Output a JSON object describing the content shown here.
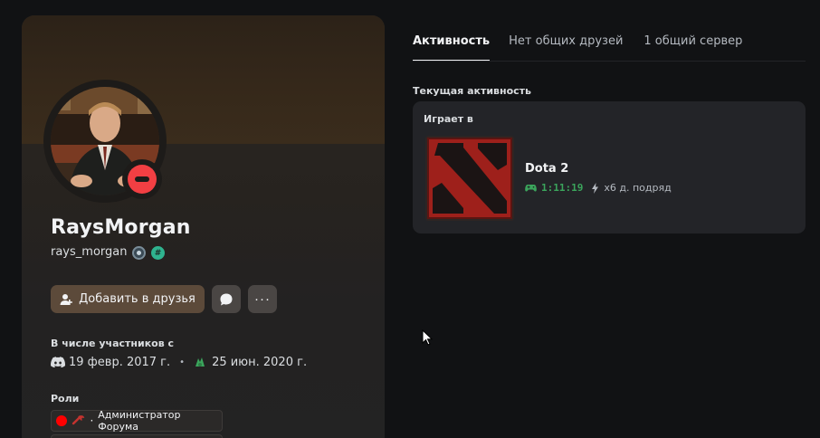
{
  "profile": {
    "display_name": "RaysMorgan",
    "username": "rays_morgan",
    "status": "dnd",
    "status_color": "#f23f43",
    "badges": [
      "hypesquad-icon",
      "hash-badge-icon"
    ],
    "badge_hash_symbol": "#"
  },
  "actions": {
    "add_friend_label": "Добавить в друзья",
    "add_friend_color": "#5c4a3a",
    "more_label": "···"
  },
  "member_since": {
    "title": "В числе участников с",
    "discord_date": "19 февр. 2017 г.",
    "separator": "•",
    "server_date": "25 июн. 2020 г."
  },
  "roles": {
    "title": "Роли",
    "items": [
      {
        "name": "Администратор Форума",
        "color": "#ff0000",
        "prefix": "·"
      }
    ]
  },
  "tabs": [
    {
      "label": "Активность",
      "active": true
    },
    {
      "label": "Нет общих друзей",
      "active": false
    },
    {
      "label": "1 общий сервер",
      "active": false
    }
  ],
  "activity": {
    "section_title": "Текущая активность",
    "playing_label": "Играет в",
    "game_name": "Dota 2",
    "elapsed": "1:11:19",
    "streak": "x6 д. подряд",
    "timer_color": "#3ba55c"
  }
}
